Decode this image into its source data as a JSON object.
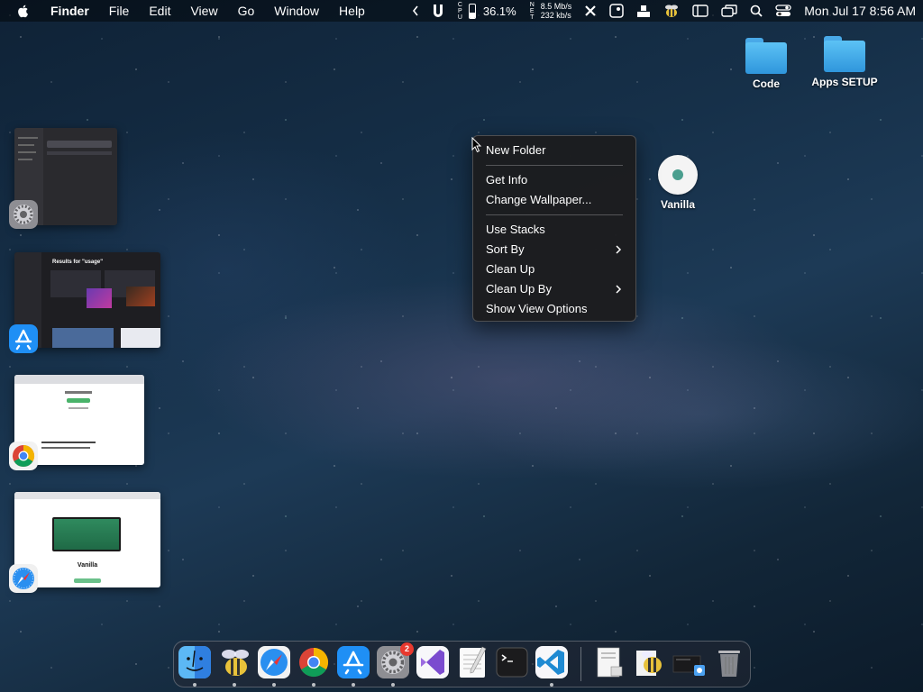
{
  "menubar": {
    "app_name": "Finder",
    "menus": [
      "File",
      "Edit",
      "View",
      "Go",
      "Window",
      "Help"
    ],
    "status": {
      "cpu_label": "CPU",
      "cpu_percent": "36.1%",
      "cpu_fraction": 0.361,
      "net_label": "NET",
      "net_down": "8.5 Mb/s",
      "net_up": "232 kb/s"
    },
    "clock": "Mon Jul 17  8:56 AM"
  },
  "desktop": {
    "icons": [
      {
        "label": "Code",
        "type": "folder-icon"
      },
      {
        "label": "Apps SETUP",
        "type": "folder-icon"
      },
      {
        "label": "Vanilla",
        "type": "vanilla-app-icon"
      }
    ]
  },
  "context_menu": {
    "groups": [
      [
        "New Folder"
      ],
      [
        "Get Info",
        "Change Wallpaper..."
      ],
      [
        "Use Stacks",
        "Sort By",
        "Clean Up",
        "Clean Up By",
        "Show View Options"
      ]
    ],
    "submenu_items": [
      "Sort By",
      "Clean Up By"
    ]
  },
  "stage_manager": {
    "apps": [
      "system-settings-icon",
      "app-store-icon",
      "chrome-icon",
      "safari-icon"
    ],
    "thumb_texts": {
      "appstore_results": "Results for \"usage\"",
      "safari_site_title": "Vanilla"
    }
  },
  "dock": {
    "items": [
      {
        "name": "finder",
        "running": true
      },
      {
        "name": "bee",
        "running": true
      },
      {
        "name": "safari",
        "running": true
      },
      {
        "name": "chrome",
        "running": true
      },
      {
        "name": "app-store",
        "running": true
      },
      {
        "name": "system-settings",
        "running": true,
        "badge": "2"
      },
      {
        "name": "visual-studio",
        "running": false
      },
      {
        "name": "textedit",
        "running": false
      },
      {
        "name": "terminal",
        "running": false
      },
      {
        "name": "vscode",
        "running": true
      }
    ]
  },
  "colors": {
    "folder": "#3ba7ea",
    "menu_bg": "#1c1c1e",
    "badge": "#e8392f"
  }
}
